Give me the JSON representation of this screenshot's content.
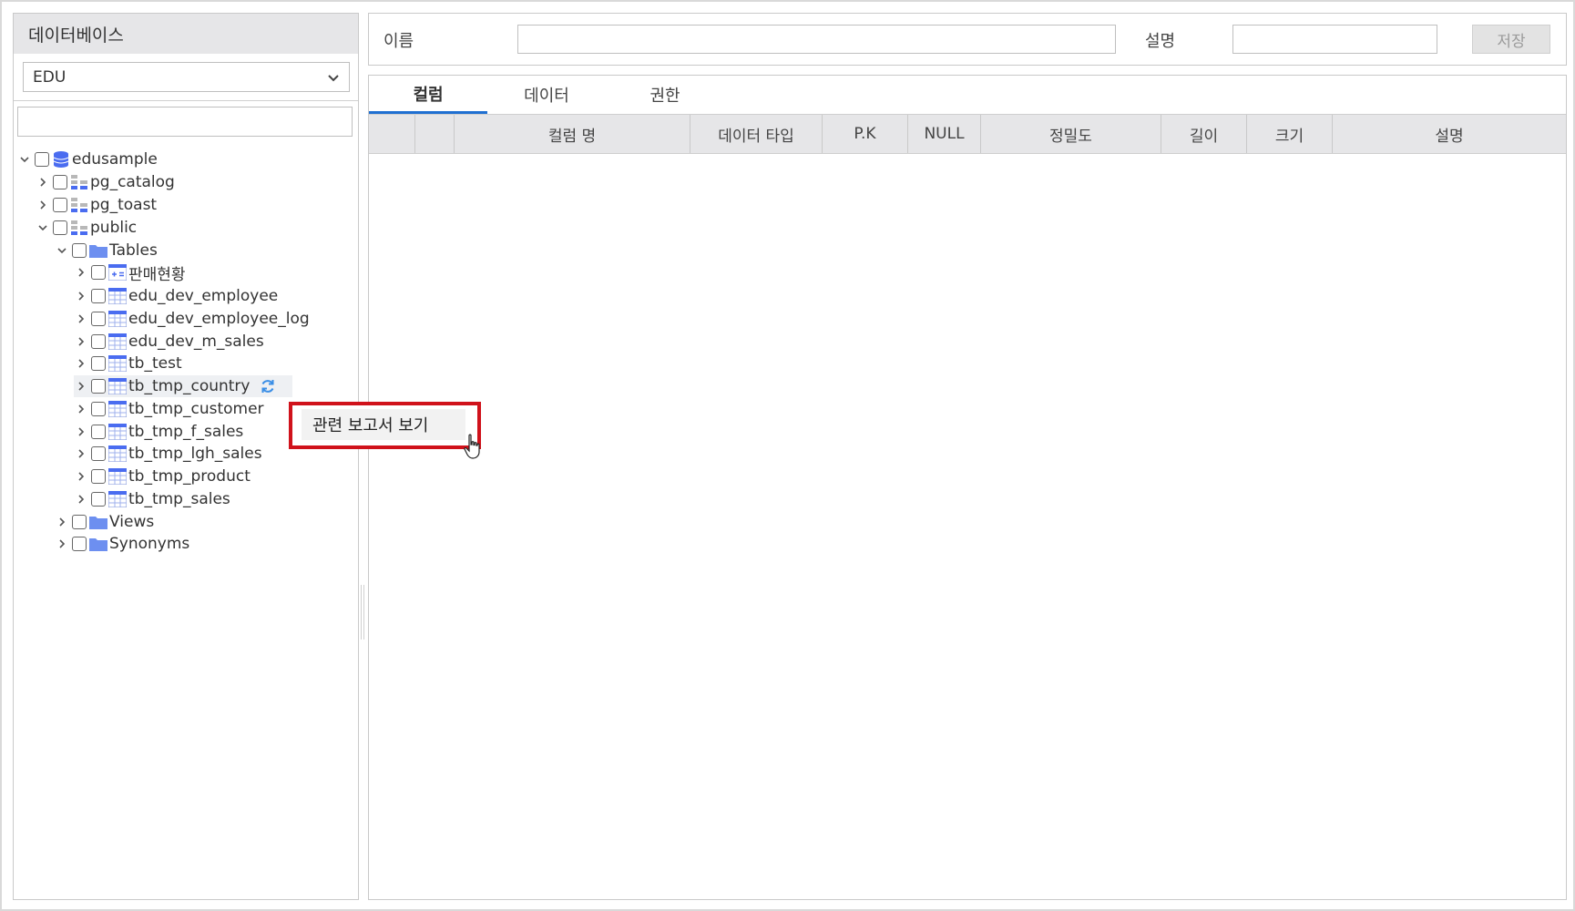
{
  "left_panel": {
    "title": "데이터베이스",
    "db_select": {
      "value": "EDU"
    },
    "filter": {
      "value": ""
    }
  },
  "tree": {
    "root": "edusample",
    "schemas": [
      "pg_catalog",
      "pg_toast",
      "public"
    ],
    "folders": {
      "tables": "Tables",
      "views": "Views",
      "synonyms": "Synonyms"
    },
    "tables": [
      "판매현황",
      "edu_dev_employee",
      "edu_dev_employee_log",
      "edu_dev_m_sales",
      "tb_test",
      "tb_tmp_country",
      "tb_tmp_customer",
      "tb_tmp_f_sales",
      "tb_tmp_lgh_sales",
      "tb_tmp_product",
      "tb_tmp_sales"
    ]
  },
  "top_bar": {
    "name_label": "이름",
    "name_value": "",
    "desc_label": "설명",
    "desc_value": "",
    "save_label": "저장"
  },
  "tabs": [
    "컬럼",
    "데이터",
    "권한"
  ],
  "grid": {
    "columns": [
      "컬럼 명",
      "데이터 타입",
      "P.K",
      "NULL",
      "정밀도",
      "길이",
      "크기",
      "설명"
    ]
  },
  "context_menu": {
    "item": "관련 보고서 보기"
  },
  "colors": {
    "accent": "#1f6fd1",
    "highlight_border": "#d0121b",
    "icon_blue": "#4a6cf0"
  }
}
